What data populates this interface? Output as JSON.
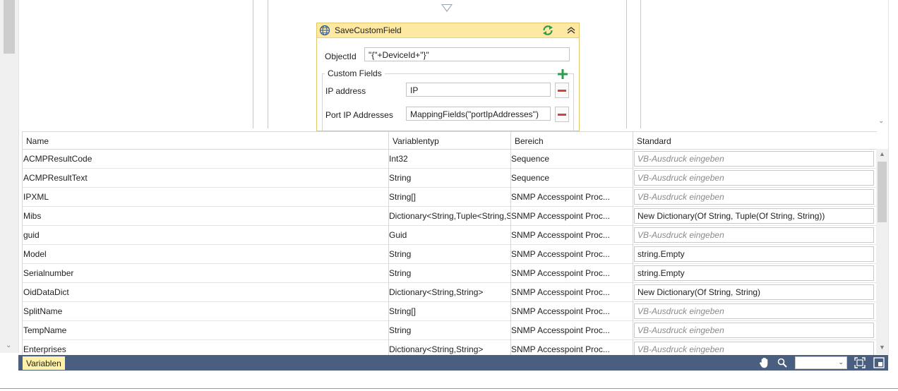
{
  "activity": {
    "title": "SaveCustomField",
    "object_id_label": "ObjectId",
    "object_id_value": "\"{\"+DeviceId+\"}\"",
    "custom_fields_label": "Custom Fields",
    "fields": [
      {
        "label": "IP address",
        "value": "IP"
      },
      {
        "label": "Port IP Addresses",
        "value": "MappingFields(\"portIpAddresses\")"
      }
    ]
  },
  "grid": {
    "headers": {
      "name": "Name",
      "type": "Variablentyp",
      "scope": "Bereich",
      "default": "Standard"
    },
    "placeholder": "VB-Ausdruck eingeben",
    "rows": [
      {
        "name": "ACMPResultCode",
        "type": "Int32",
        "scope": "Sequence",
        "default": ""
      },
      {
        "name": "ACMPResultText",
        "type": "String",
        "scope": "Sequence",
        "default": ""
      },
      {
        "name": "IPXML",
        "type": "String[]",
        "scope": "SNMP Accesspoint Proc...",
        "default": ""
      },
      {
        "name": "Mibs",
        "type": "Dictionary<String,Tuple<String,S",
        "scope": "SNMP Accesspoint Proc...",
        "default": "New Dictionary(Of String, Tuple(Of String, String))"
      },
      {
        "name": "guid",
        "type": "Guid",
        "scope": "SNMP Accesspoint Proc...",
        "default": ""
      },
      {
        "name": "Model",
        "type": "String",
        "scope": "SNMP Accesspoint Proc...",
        "default": "string.Empty"
      },
      {
        "name": "Serialnumber",
        "type": "String",
        "scope": "SNMP Accesspoint Proc...",
        "default": "string.Empty"
      },
      {
        "name": "OidDataDict",
        "type": "Dictionary<String,String>",
        "scope": "SNMP Accesspoint Proc...",
        "default": "New Dictionary(Of String, String)"
      },
      {
        "name": "SplitName",
        "type": "String[]",
        "scope": "SNMP Accesspoint Proc...",
        "default": ""
      },
      {
        "name": "TempName",
        "type": "String",
        "scope": "SNMP Accesspoint Proc...",
        "default": ""
      },
      {
        "name": "Enterprises",
        "type": "Dictionary<String,String>",
        "scope": "SNMP Accesspoint Proc...",
        "default": ""
      }
    ]
  },
  "statusbar": {
    "variables_tab": "Variablen",
    "zoom_value": ""
  },
  "colors": {
    "statusbar": "#4a5e80",
    "tab_highlight": "#fff1a8",
    "activity_header": "#fde9a2",
    "accent_green": "#2e9b4f",
    "minus_red": "#d9403a"
  }
}
